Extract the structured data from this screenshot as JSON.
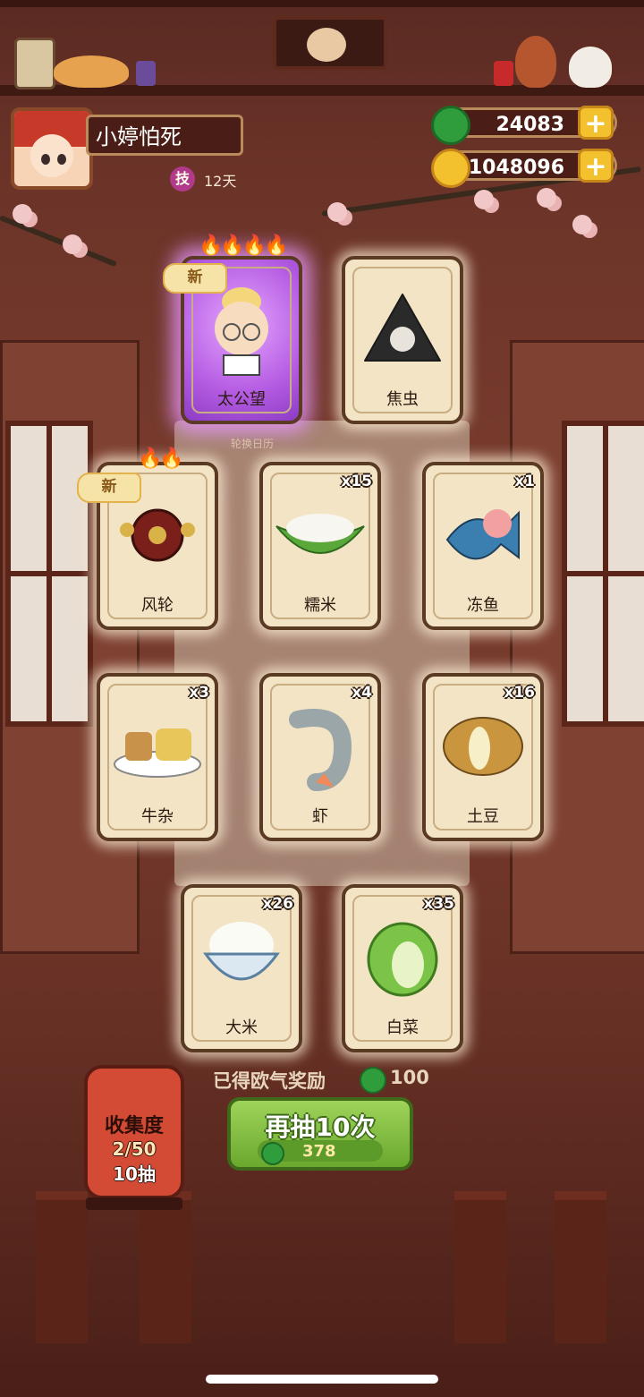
{
  "profile": {
    "name": "小婷怕死",
    "skill_badge": "技",
    "days": "12天"
  },
  "currency": {
    "jade": "24083",
    "coins": "1048096",
    "plus": "+"
  },
  "calendar_note": "轮换日历",
  "cards": [
    {
      "label": "太公望",
      "count": "",
      "rarity": "purple",
      "new": "新",
      "flames": "4"
    },
    {
      "label": "焦虫",
      "count": "",
      "rarity": "normal",
      "new": "",
      "flames": "0"
    },
    {
      "label": "风轮",
      "count": "",
      "rarity": "normal",
      "new": "新",
      "flames": "2"
    },
    {
      "label": "糯米",
      "count": "x15",
      "rarity": "normal",
      "new": "",
      "flames": "0"
    },
    {
      "label": "冻鱼",
      "count": "x1",
      "rarity": "normal",
      "new": "",
      "flames": "0"
    },
    {
      "label": "牛杂",
      "count": "x3",
      "rarity": "normal",
      "new": "",
      "flames": "0"
    },
    {
      "label": "虾",
      "count": "x4",
      "rarity": "normal",
      "new": "",
      "flames": "0"
    },
    {
      "label": "土豆",
      "count": "x16",
      "rarity": "normal",
      "new": "",
      "flames": "0"
    },
    {
      "label": "大米",
      "count": "x26",
      "rarity": "normal",
      "new": "",
      "flames": "0"
    },
    {
      "label": "白菜",
      "count": "x35",
      "rarity": "normal",
      "new": "",
      "flames": "0"
    }
  ],
  "reward": {
    "text": "已得欧气奖励",
    "value": "100"
  },
  "collection": {
    "title": "收集度",
    "progress": "2/50",
    "draws": "10抽"
  },
  "draw_button": {
    "label": "再抽10次",
    "cost": "378"
  },
  "colors": {
    "jade_green": "#2f9d3b",
    "coin_gold": "#f3c02e",
    "button_green": "#7fbf3f",
    "purple_rarity": "#b55de3"
  }
}
